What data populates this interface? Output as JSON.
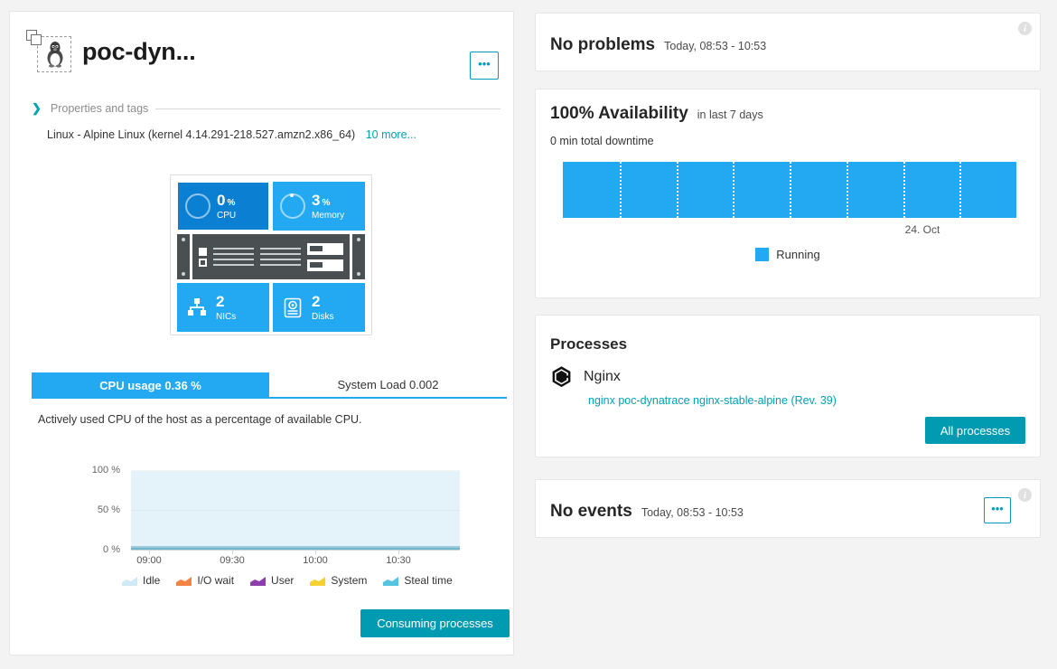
{
  "host": {
    "title": "poc-dyn...",
    "icon": "linux-tux-host-icon",
    "more_button": "•••",
    "properties_label": "Properties and tags",
    "os_line": "Linux - Alpine Linux (kernel 4.14.291-218.527.amzn2.x86_64)",
    "os_more": "10 more...",
    "tiles": [
      {
        "name": "cpu",
        "value": "0",
        "unit": "%",
        "label": "CPU",
        "selected": true
      },
      {
        "name": "memory",
        "value": "3",
        "unit": "%",
        "label": "Memory",
        "selected": false
      },
      {
        "name": "nics",
        "value": "2",
        "unit": "",
        "label": "NICs",
        "selected": false
      },
      {
        "name": "disks",
        "value": "2",
        "unit": "",
        "label": "Disks",
        "selected": false
      }
    ]
  },
  "metric_tabs": {
    "active": "CPU usage 0.36 %",
    "inactive": "System Load 0.002",
    "description": "Actively used CPU of the host as a percentage of available CPU.",
    "consuming_button": "Consuming processes"
  },
  "chart_data": {
    "type": "area",
    "title": "CPU usage 0.36 %",
    "xlabel": "",
    "ylabel": "",
    "ylim": [
      0,
      100
    ],
    "ytick_labels": [
      "100 %",
      "50 %",
      "0 %"
    ],
    "ytick_values": [
      100,
      50,
      0
    ],
    "x": [
      "09:00",
      "09:30",
      "10:00",
      "10:30"
    ],
    "grid": true,
    "legend_position": "bottom",
    "series": [
      {
        "name": "Idle",
        "color": "#d8ecf8",
        "values": [
          99.6,
          99.6,
          99.6,
          99.6
        ]
      },
      {
        "name": "I/O wait",
        "color": "#f58345",
        "values": [
          0.0,
          0.0,
          0.0,
          0.0
        ]
      },
      {
        "name": "User",
        "color": "#8c3fa8",
        "values": [
          0.2,
          0.2,
          0.2,
          0.2
        ]
      },
      {
        "name": "System",
        "color": "#f5d130",
        "values": [
          0.1,
          0.1,
          0.1,
          0.1
        ]
      },
      {
        "name": "Steal time",
        "color": "#55c4e0",
        "values": [
          0.1,
          0.1,
          0.1,
          0.1
        ]
      }
    ]
  },
  "problems": {
    "title": "No problems",
    "timerange": "Today, 08:53 - 10:53",
    "info": "i"
  },
  "availability": {
    "title": "100% Availability",
    "subtitle": "in last 7 days",
    "downtime": "0 min total downtime",
    "date_label": "24. Oct",
    "legend_label": "Running",
    "legend_color": "#22a9f1",
    "segments": 8
  },
  "processes": {
    "title": "Processes",
    "item_icon": "nginx-icon",
    "item_name": "Nginx",
    "item_link": "nginx poc-dynatrace nginx-stable-alpine (Rev. 39)",
    "all_button": "All processes"
  },
  "events": {
    "title": "No events",
    "timerange": "Today, 08:53 - 10:53",
    "more_button": "•••",
    "info": "i"
  }
}
